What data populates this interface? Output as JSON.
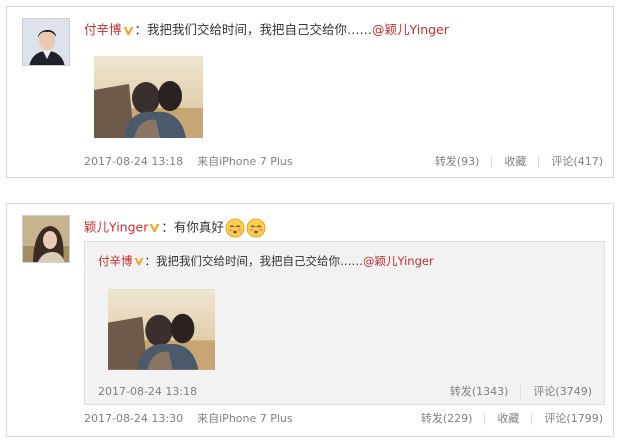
{
  "post1": {
    "author": "付辛博",
    "text": "：我把我们交给时间，我把自己交给你……",
    "mention": "@颖儿Yinger",
    "timestamp": "2017-08-24 13:18",
    "source": "来自iPhone 7 Plus",
    "repost_label": "转发(93)",
    "favorite_label": "收藏",
    "comment_label": "评论(417)",
    "avatar_icon": "male-avatar",
    "image_icon": "couple-photo"
  },
  "post2": {
    "author": "颖儿Yinger",
    "text": "：有你真好",
    "emoji_icons": [
      "blush-face-emoji",
      "blush-face-emoji"
    ],
    "timestamp": "2017-08-24 13:30",
    "source": "来自iPhone 7 Plus",
    "repost_label": "转发(229)",
    "favorite_label": "收藏",
    "comment_label": "评论(1799)",
    "avatar_icon": "female-avatar",
    "quoted": {
      "author": "付辛博",
      "text": "：我把我们交给时间，我把自己交给你……",
      "mention": "@颖儿Yinger",
      "timestamp": "2017-08-24 13:18",
      "repost_label": "转发(1343)",
      "comment_label": "评论(3749)",
      "image_icon": "couple-photo"
    }
  },
  "colors": {
    "username": "#c62e2e",
    "meta_text": "#808080",
    "badge": "#f5a623",
    "quoted_bg": "#f2f2f2",
    "card_border": "#d9d9d9"
  }
}
